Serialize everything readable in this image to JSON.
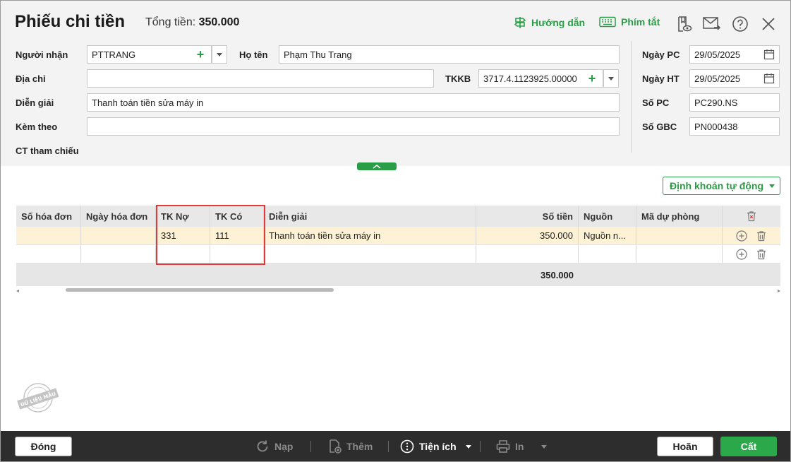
{
  "header": {
    "title": "Phiếu chi tiền",
    "total_label": "Tổng tiền:",
    "total_value": "350.000",
    "guide_label": "Hướng dẫn",
    "shortcut_label": "Phím tắt"
  },
  "form": {
    "recipient": {
      "label": "Người nhận",
      "value": "PTTRANG"
    },
    "fullname": {
      "label": "Họ tên",
      "value": "Phạm Thu Trang"
    },
    "address": {
      "label": "Địa chỉ",
      "value": ""
    },
    "bank_account": {
      "label": "TKKB",
      "value": "3717.4.1123925.00000"
    },
    "description": {
      "label": "Diễn giải",
      "value": "Thanh toán tiền sửa máy in"
    },
    "attachment": {
      "label": "Kèm theo",
      "value": ""
    },
    "reference": {
      "label": "CT tham chiếu"
    },
    "date_pc": {
      "label": "Ngày PC",
      "value": "29/05/2025"
    },
    "date_ht": {
      "label": "Ngày HT",
      "value": "29/05/2025"
    },
    "so_pc": {
      "label": "Số PC",
      "value": "PC290.NS"
    },
    "so_gbc": {
      "label": "Số GBC",
      "value": "PN000438"
    }
  },
  "auto_entry_label": "Định khoản tự động",
  "table": {
    "columns": [
      "Số hóa đơn",
      "Ngày hóa đơn",
      "TK Nợ",
      "TK Có",
      "Diễn giải",
      "Số tiền",
      "Nguồn",
      "Mã dự phòng"
    ],
    "rows": [
      [
        "",
        "",
        "331",
        "111",
        "Thanh toán tiền sửa máy in",
        "350.000",
        "Nguồn n...",
        ""
      ],
      [
        "",
        "",
        "",
        "",
        "",
        "",
        "",
        ""
      ]
    ],
    "total_amount": "350.000"
  },
  "watermark": "DỮ LIỆU MẪU",
  "footer": {
    "close_label": "Đóng",
    "reload_label": "Nạp",
    "add_label": "Thêm",
    "utility_label": "Tiện ích",
    "print_label": "In",
    "cancel_label": "Hoãn",
    "save_label": "Cất"
  },
  "colors": {
    "accent": "#2a9d46",
    "highlight_border": "#e03a3a",
    "selected_row": "#fdf2d6",
    "footer_bg": "#2d2d2d"
  }
}
